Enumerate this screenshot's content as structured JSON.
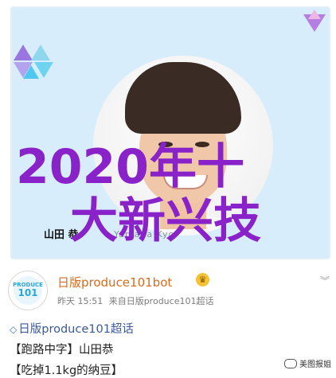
{
  "card": {
    "name_label": "山田 恭",
    "name_ghost": "Yamada Kyo"
  },
  "overlay": {
    "line1": "2020年十",
    "line2": "大新兴技"
  },
  "post": {
    "avatar_small": "PRODUCE",
    "avatar_num": "101",
    "author": "日版produce101bot",
    "meta_time": "昨天 15:51",
    "meta_source": "来自日版produce101超话",
    "line1": "日版produce101超话",
    "line2": "【跑路中字】山田恭",
    "line3": "【吃掉1.1kg的纳豆】"
  },
  "watermark": {
    "text": "美图报姐"
  },
  "icons": {
    "crown": "crown-icon",
    "chevron": "chevron-down-icon",
    "diamond": "diamond-icon"
  },
  "colors": {
    "overlay": "#8a22c9",
    "author": "#d96b1b",
    "card_bg": "#d8edfb"
  }
}
